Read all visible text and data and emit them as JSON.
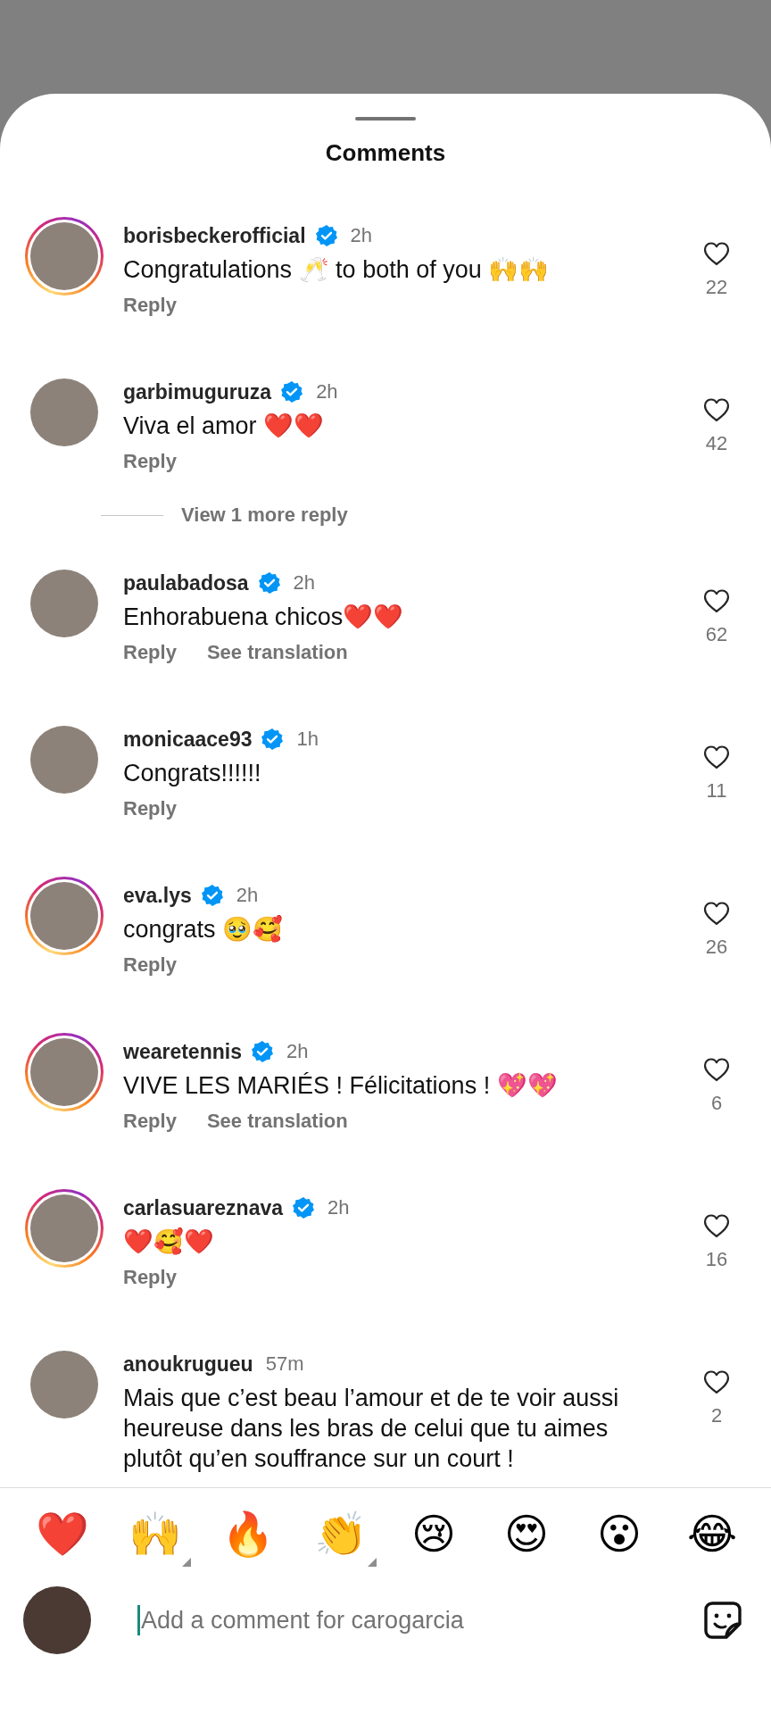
{
  "sheet": {
    "title": "Comments"
  },
  "comments": [
    {
      "username": "borisbeckerofficial",
      "verified": true,
      "time": "2h",
      "story_ring": true,
      "text": "Congratulations 🥂 to both of you 🙌🙌",
      "actions": [
        "Reply"
      ],
      "likes": "22",
      "liked": false
    },
    {
      "username": "garbimuguruza",
      "verified": true,
      "time": "2h",
      "story_ring": false,
      "text": "Viva el amor ❤️❤️",
      "actions": [
        "Reply"
      ],
      "likes": "42",
      "liked": false,
      "more_replies": "View 1 more reply"
    },
    {
      "username": "paulabadosa",
      "verified": true,
      "time": "2h",
      "story_ring": false,
      "text": "Enhorabuena chicos❤️❤️",
      "actions": [
        "Reply",
        "See translation"
      ],
      "likes": "62",
      "liked": false
    },
    {
      "username": "monicaace93",
      "verified": true,
      "time": "1h",
      "story_ring": false,
      "text": "Congrats!!!!!!",
      "actions": [
        "Reply"
      ],
      "likes": "11",
      "liked": false
    },
    {
      "username": "eva.lys",
      "verified": true,
      "time": "2h",
      "story_ring": true,
      "text": "congrats 🥹🥰",
      "actions": [
        "Reply"
      ],
      "likes": "26",
      "liked": false
    },
    {
      "username": "wearetennis",
      "verified": true,
      "time": "2h",
      "story_ring": true,
      "text": "VIVE LES MARIÉS ! Félicitations ! 💖💖",
      "actions": [
        "Reply",
        "See translation"
      ],
      "likes": "6",
      "liked": false
    },
    {
      "username": "carlasuareznava",
      "verified": true,
      "time": "2h",
      "story_ring": true,
      "text": "❤️🥰❤️",
      "actions": [
        "Reply"
      ],
      "likes": "16",
      "liked": false
    },
    {
      "username": "anoukrugueu",
      "verified": false,
      "time": "57m",
      "story_ring": false,
      "text": "Mais que c’est beau l’amour et de te voir aussi heureuse dans les bras de celui que tu aimes plutôt qu’en souffrance sur un court !",
      "likes": "2",
      "liked": false
    }
  ],
  "quick_reactions": [
    {
      "emoji": "❤️",
      "has_variants": false
    },
    {
      "emoji": "🙌",
      "has_variants": true
    },
    {
      "emoji": "🔥",
      "has_variants": false
    },
    {
      "emoji": "👏",
      "has_variants": true
    },
    {
      "emoji": "😢",
      "has_variants": false
    },
    {
      "emoji": "😍",
      "has_variants": false
    },
    {
      "emoji": "😮",
      "has_variants": false
    },
    {
      "emoji": "😂",
      "has_variants": false
    }
  ],
  "composer": {
    "placeholder": "Add a comment for carogarcia"
  }
}
